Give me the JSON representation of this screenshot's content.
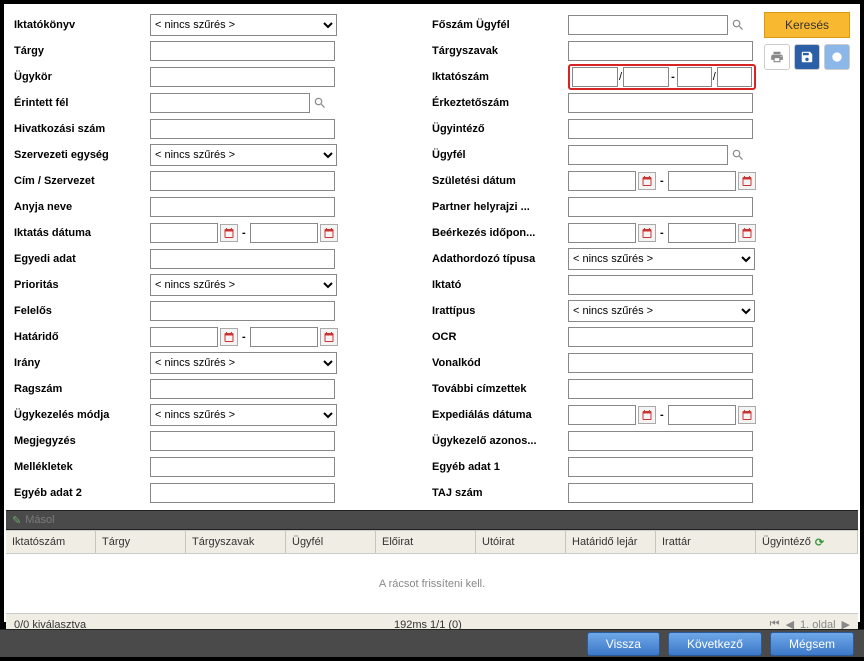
{
  "topright": {
    "search": "Keresés"
  },
  "noFilter": "< nincs szűrés >",
  "left": {
    "iktatokonyv": "Iktatókönyv",
    "targy": "Tárgy",
    "ugykor": "Ügykör",
    "erintett": "Érintett fél",
    "hivatkozasi": "Hivatkozási szám",
    "szervezeti": "Szervezeti egység",
    "cim": "Cím / Szervezet",
    "anyja": "Anyja neve",
    "iktatasDatuma": "Iktatás dátuma",
    "egyediAdat": "Egyedi adat",
    "prioritas": "Prioritás",
    "felelos": "Felelős",
    "hatarido": "Határidő",
    "irany": "Irány",
    "ragszam": "Ragszám",
    "ugykezelesModja": "Ügykezelés módja",
    "megjegyzes": "Megjegyzés",
    "mellekletek": "Mellékletek",
    "egyebAdat2": "Egyéb adat 2"
  },
  "right": {
    "foszamUgyfel": "Főszám Ügyfél",
    "targyszavak": "Tárgyszavak",
    "iktatoszam": "Iktatószám",
    "erkeztetoszam": "Érkeztetőszám",
    "ugyintezo": "Ügyintéző",
    "ugyfel": "Ügyfél",
    "szuletesi": "Születési dátum",
    "partnerHelyrajzi": "Partner helyrajzi ...",
    "beerkezes": "Beérkezés időpon...",
    "adathordozo": "Adathordozó típusa",
    "iktato": "Iktató",
    "irattipus": "Irattípus",
    "ocr": "OCR",
    "vonalkod": "Vonalkód",
    "tovabbiCimzettek": "További címzettek",
    "expedialas": "Expediálás dátuma",
    "ugykezeloAzonos": "Ügykezelő azonos...",
    "egyebAdat1": "Egyéb adat 1",
    "tajSzam": "TAJ szám"
  },
  "grid": {
    "toolbar": {
      "masol": "Másol"
    },
    "headers": {
      "iktatoszam": "Iktatószám",
      "targy": "Tárgy",
      "targyszavak": "Tárgyszavak",
      "ugyfel": "Ügyfél",
      "eloirat": "Előirat",
      "utoirat": "Utóirat",
      "hataridoLejar": "Határidő lejár",
      "irattar": "Irattár",
      "ugyintezo": "Ügyintéző"
    },
    "emptyMsg": "A rácsot frissíteni kell.",
    "footer": {
      "selection": "0/0 kiválasztva",
      "timing": "192ms 1/1 (0)",
      "page": "1. oldal"
    }
  },
  "bottom": {
    "vissza": "Vissza",
    "kovetkezo": "Következő",
    "megsem": "Mégsem"
  }
}
